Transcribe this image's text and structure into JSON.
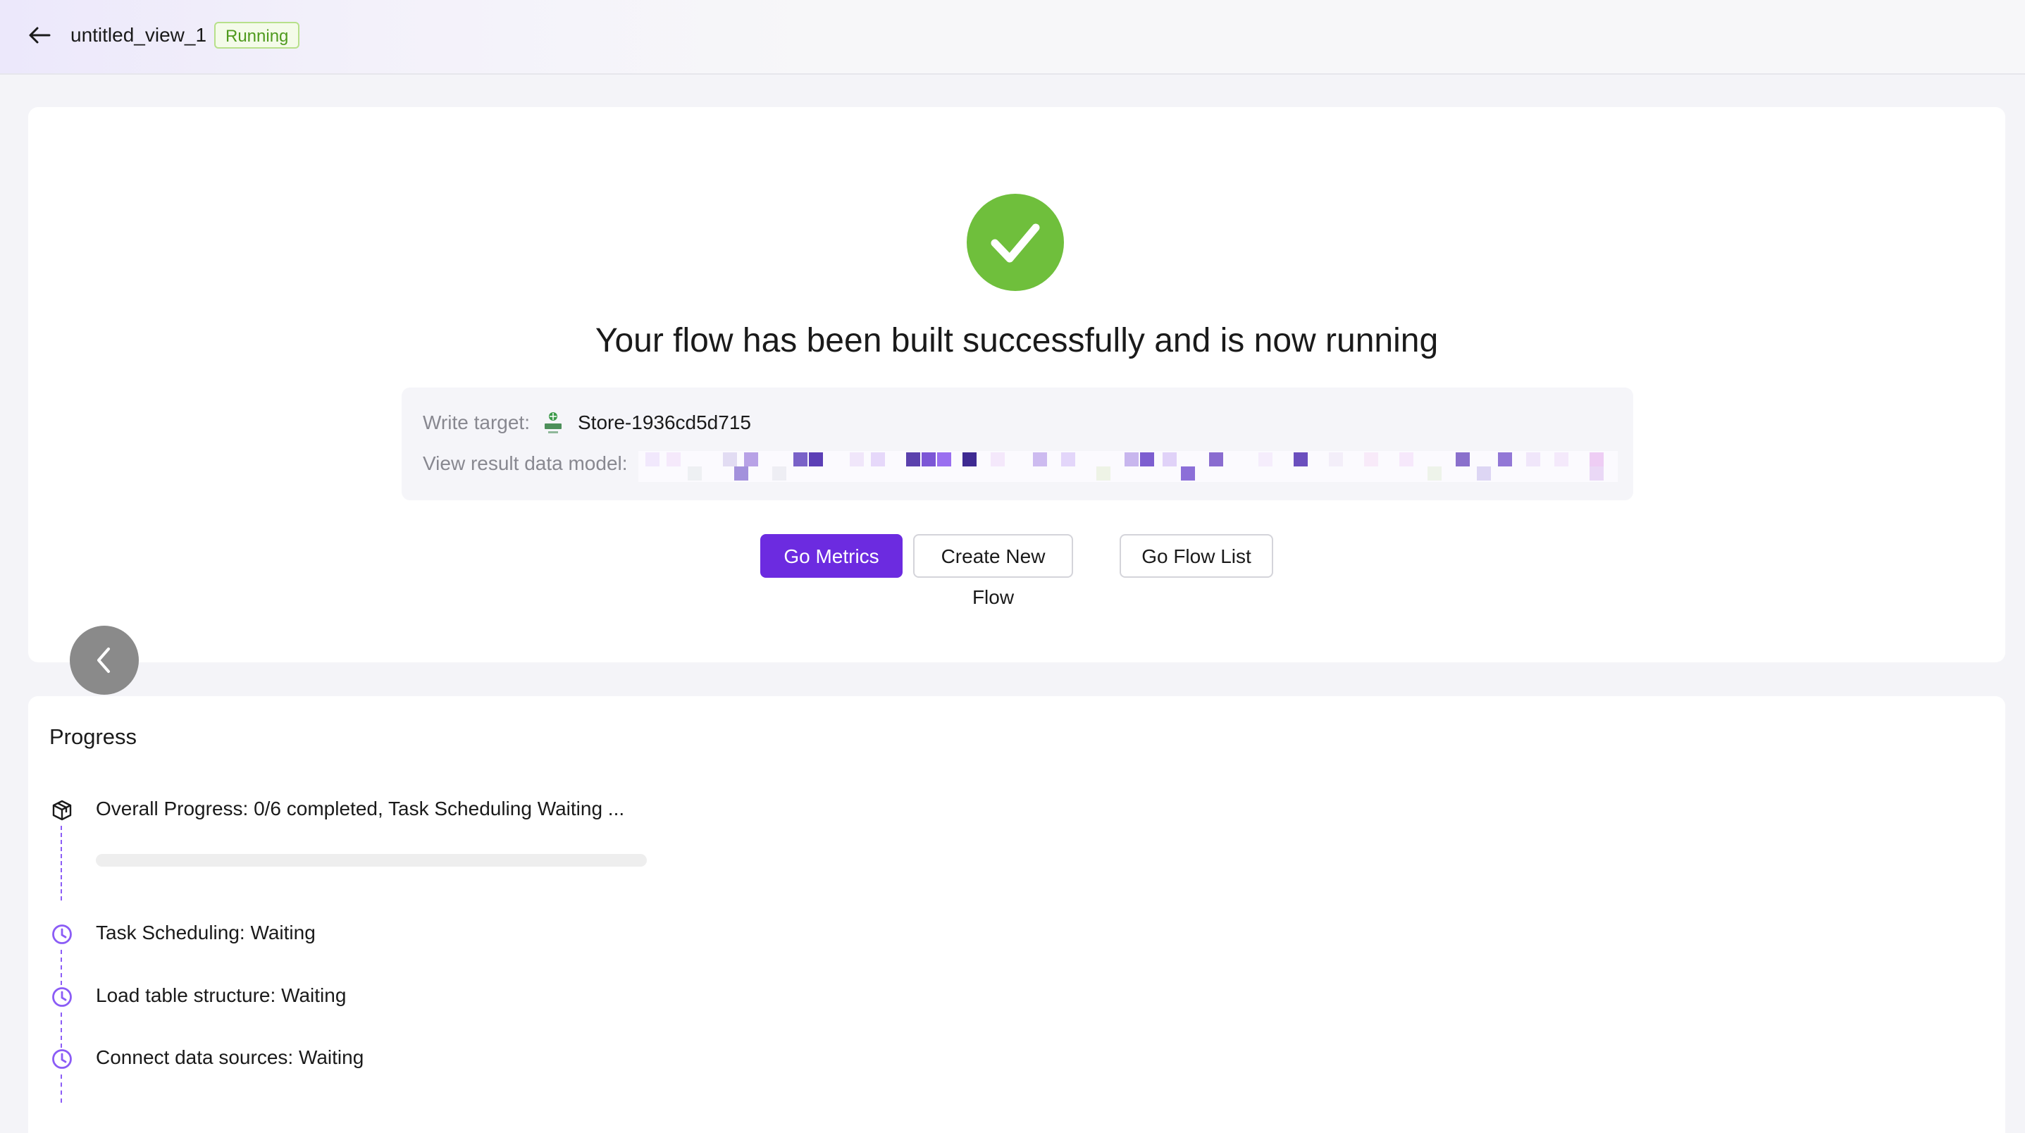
{
  "header": {
    "title": "untitled_view_1",
    "status": "Running"
  },
  "result": {
    "headline": "Your flow has been built successfully and is now running",
    "write_target_label": "Write target:",
    "write_target_value": "Store-1936cd5d715",
    "view_model_label": "View result data model:",
    "actions": {
      "go_metrics": "Go Metrics",
      "create_new_flow": "Create New Flow",
      "go_flow_list": "Go Flow List"
    }
  },
  "progress": {
    "title": "Progress",
    "overall": {
      "label": "Overall Progress:",
      "value": "0/6 completed, Task Scheduling Waiting ...",
      "fraction": 0
    },
    "steps": [
      {
        "label": "Task Scheduling:",
        "status": "Waiting"
      },
      {
        "label": "Load table structure:",
        "status": "Waiting"
      },
      {
        "label": "Connect data sources:",
        "status": "Waiting"
      }
    ]
  },
  "colors": {
    "accent": "#6c2be0",
    "success": "#6fbf3c",
    "status_running": "#4f9a1e",
    "step_icon": "#8b5cf6"
  },
  "icons": {
    "back": "arrow-left-icon",
    "success": "checkmark-circle-icon",
    "prev": "chevron-left-icon",
    "overall": "cube-icon",
    "step": "clock-icon"
  }
}
